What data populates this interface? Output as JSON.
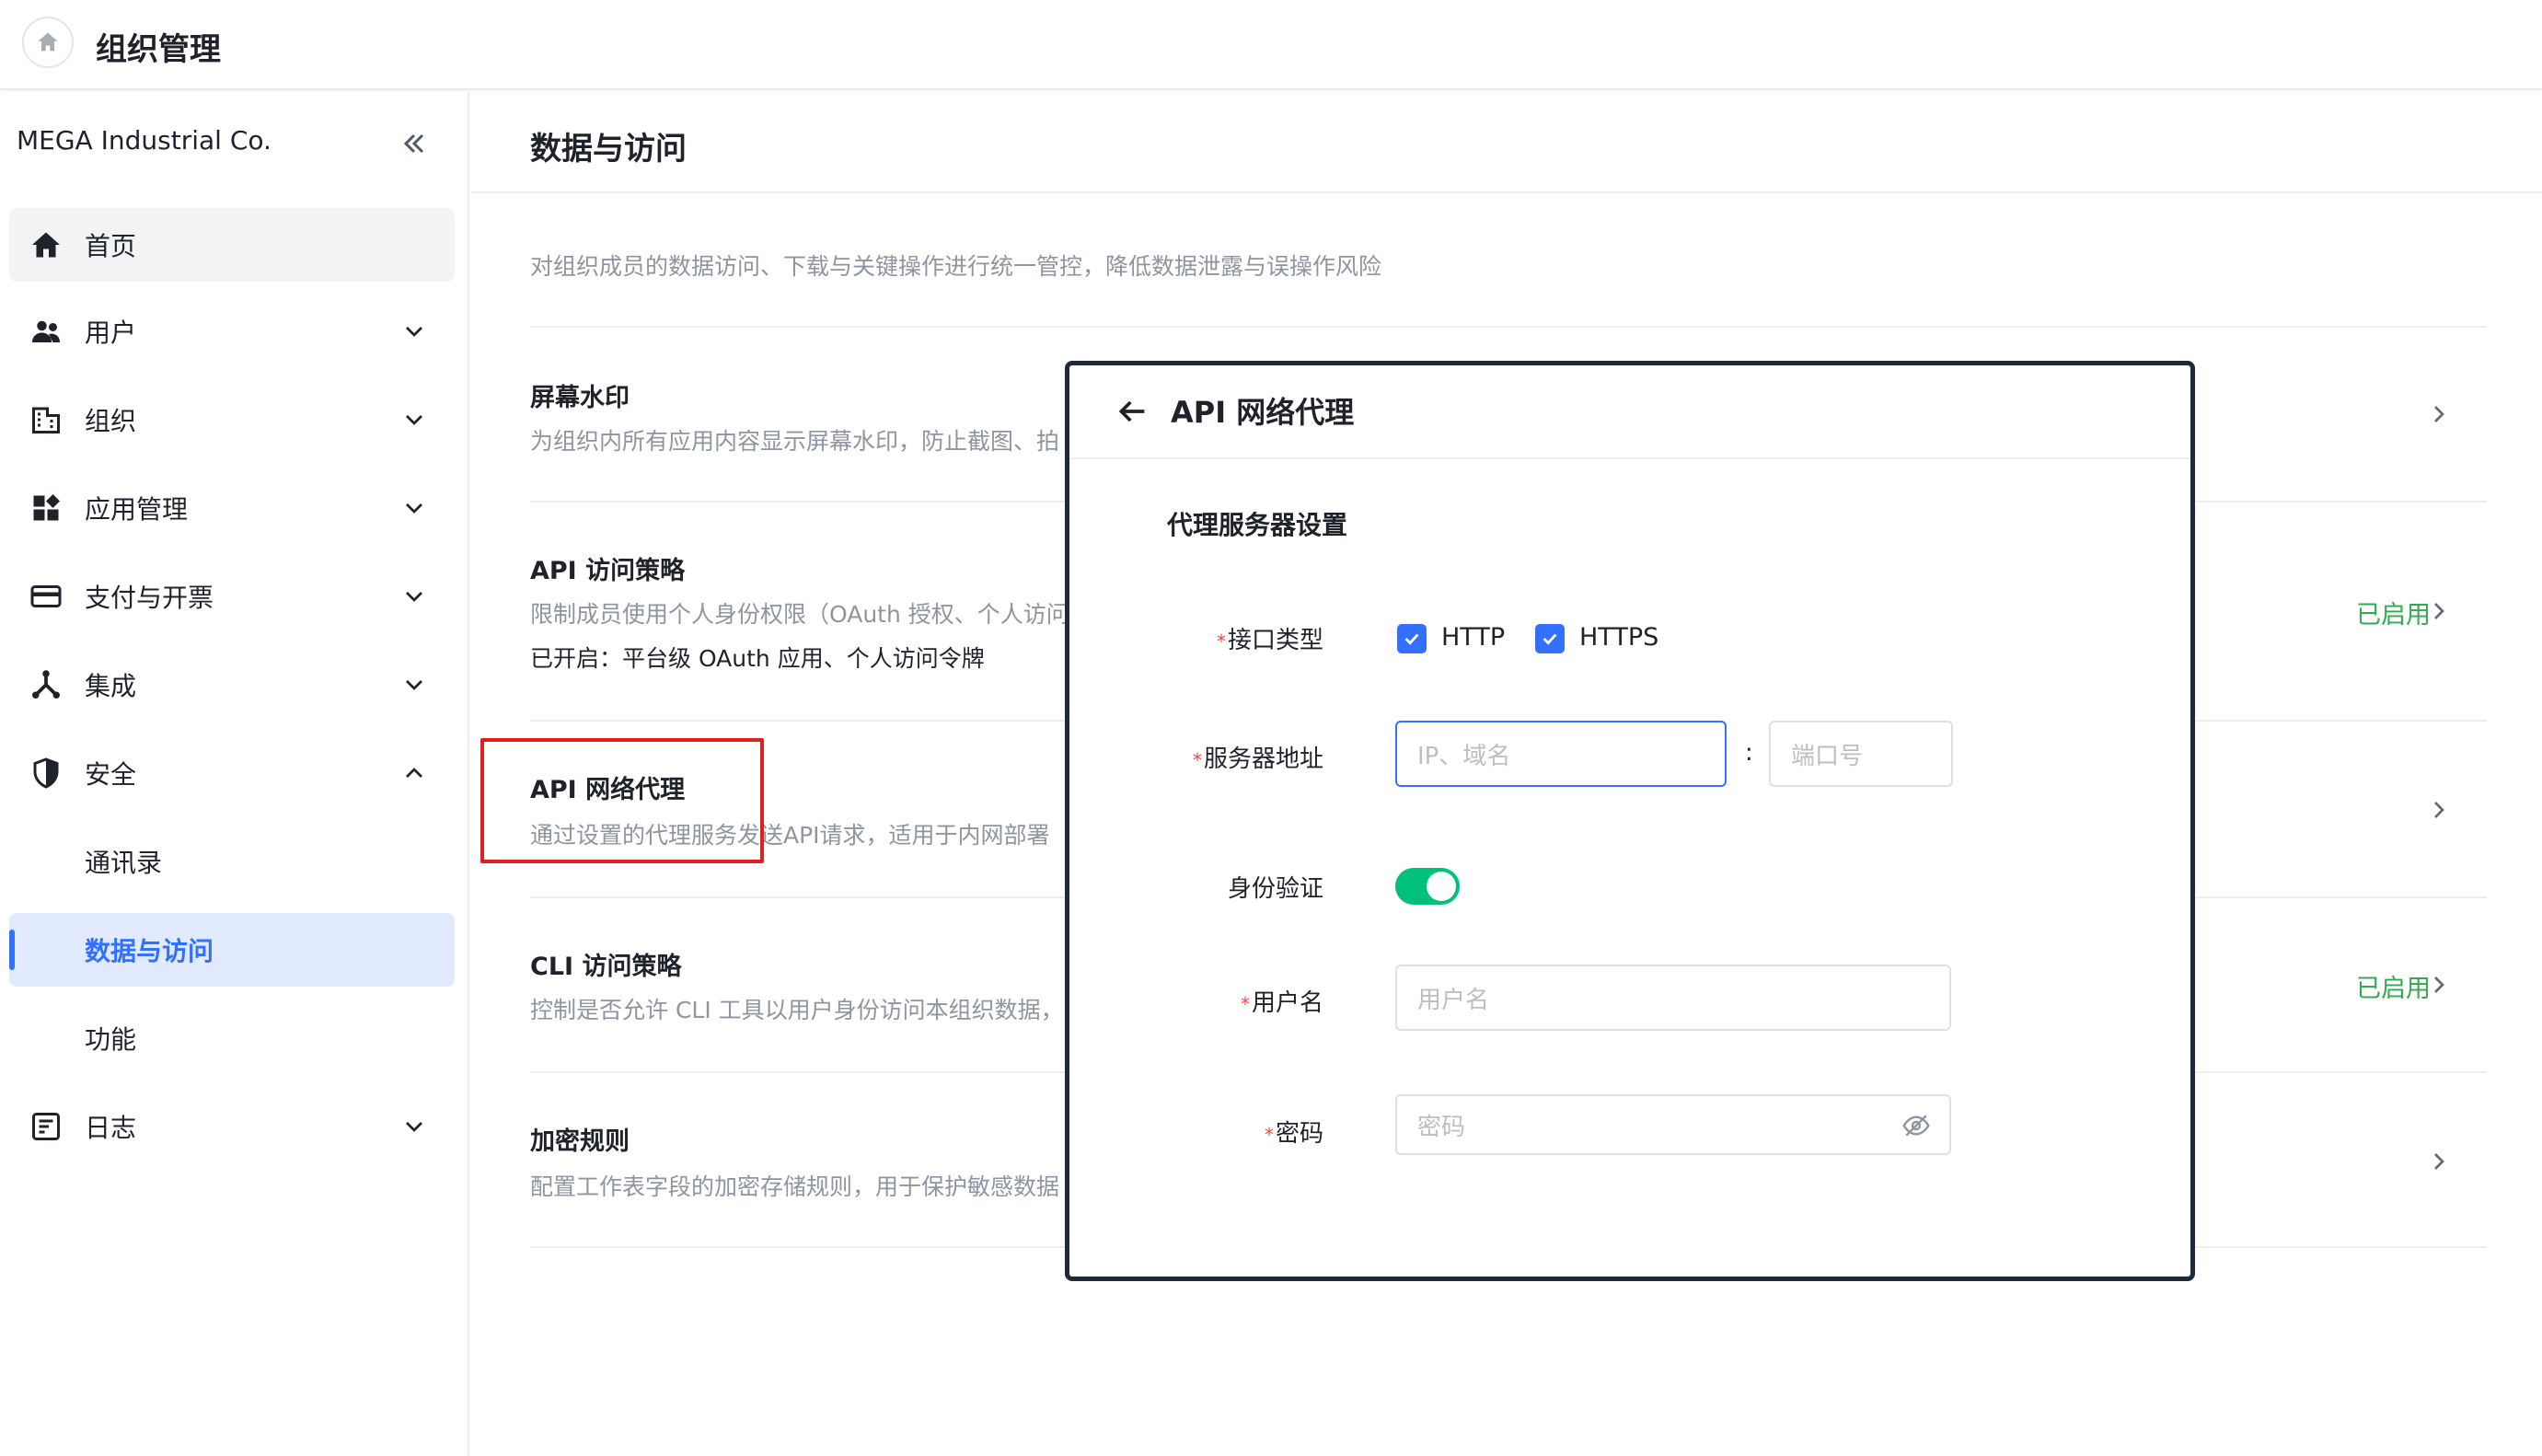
{
  "topbar": {
    "title": "组织管理"
  },
  "sidebar": {
    "org_name": "MEGA Industrial Co.",
    "items": [
      {
        "label": "首页"
      },
      {
        "label": "用户"
      },
      {
        "label": "组织"
      },
      {
        "label": "应用管理"
      },
      {
        "label": "支付与开票"
      },
      {
        "label": "集成"
      },
      {
        "label": "安全"
      },
      {
        "label": "通讯录"
      },
      {
        "label": "数据与访问"
      },
      {
        "label": "功能"
      },
      {
        "label": "日志"
      }
    ]
  },
  "main": {
    "title": "数据与访问",
    "description": "对组织成员的数据访问、下载与关键操作进行统一管控，降低数据泄露与误操作风险",
    "rows": [
      {
        "title": "屏幕水印",
        "desc": "为组织内所有应用内容显示屏幕水印，防止截图、拍",
        "status": ""
      },
      {
        "title": "API 访问策略",
        "desc": "限制成员使用个人身份权限（OAuth 授权、个人访问",
        "sub": "已开启：平台级 OAuth 应用、个人访问令牌",
        "status": "已启用"
      },
      {
        "title": "API 网络代理",
        "desc": "通过设置的代理服务发送API请求，适用于内网部署",
        "status": ""
      },
      {
        "title": "CLI 访问策略",
        "desc": "控制是否允许 CLI 工具以用户身份访问本组织数据，",
        "status": "已启用"
      },
      {
        "title": "加密规则",
        "desc": "配置工作表字段的加密存储规则，用于保护敏感数据",
        "status": ""
      }
    ]
  },
  "modal": {
    "title": "API 网络代理",
    "section_title": "代理服务器设置",
    "protocol_label": "接口类型",
    "required_mark": "*",
    "http_label": "HTTP",
    "https_label": "HTTPS",
    "http_checked": true,
    "https_checked": true,
    "server_label": "服务器地址",
    "host_placeholder": "IP、域名",
    "colon": ":",
    "port_placeholder": "端口号",
    "auth_label": "身份验证",
    "auth_enabled": true,
    "username_label": "用户名",
    "username_placeholder": "用户名",
    "password_label": "密码",
    "password_placeholder": "密码"
  },
  "colors": {
    "accent": "#3370ff",
    "enabled_green": "#34a853",
    "toggle_on": "#00c17a",
    "highlight": "#e02020"
  }
}
